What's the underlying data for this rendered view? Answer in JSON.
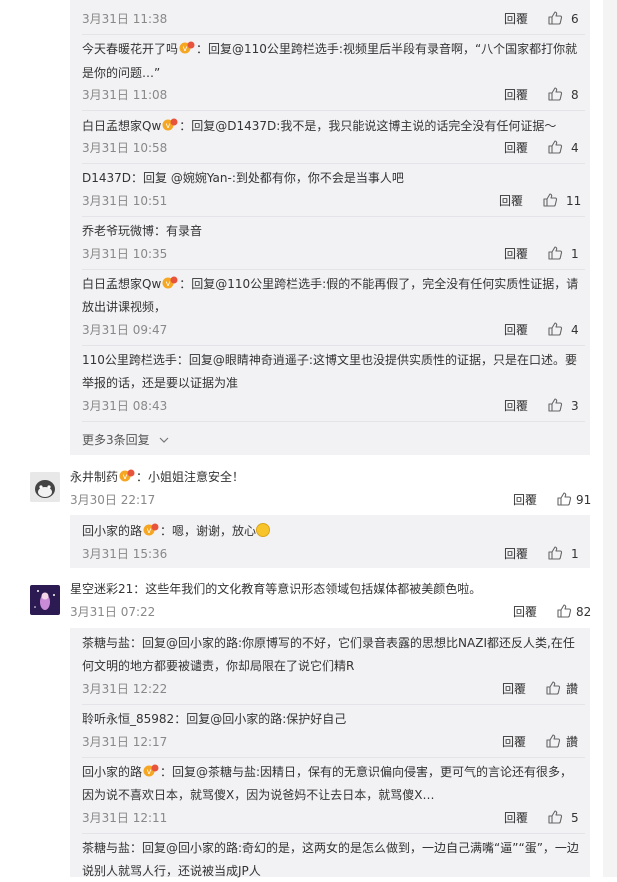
{
  "actions": {
    "reply": "回覆",
    "more_replies": "更多3条回复",
    "praise": "讚"
  },
  "comments": [
    {
      "time": "3月31日 11:38",
      "likes": "6"
    },
    {
      "name": "今天春暖花开了吗",
      "text1": "：回复@110公里跨栏选手:视频里后半段有录音啊，“八个国家都打你就",
      "text2": "是你的问题…”",
      "time": "3月31日 11:08",
      "likes": "8"
    },
    {
      "name": "白日孟想家Qw",
      "text1": "：回复@D1437D:我不是，我只能说这博主说的话完全没有任何证据～",
      "time": "3月31日 10:58",
      "likes": "4"
    },
    {
      "name": "D1437D",
      "text1": "：回复 @婉婉Yan-:到处都有你，你不会是当事人吧",
      "time": "3月31日 10:51",
      "likes": "11"
    },
    {
      "name": "乔老爷玩微博",
      "text1": "：有录音",
      "time": "3月31日 10:35",
      "likes": "1"
    },
    {
      "name": "白日孟想家Qw",
      "text1": "：回复@110公里跨栏选手:假的不能再假了，完全没有任何实质性证据，请",
      "text2": "放出讲课视频，",
      "time": "3月31日 09:47",
      "likes": "4"
    },
    {
      "name": "110公里跨栏选手",
      "text1": "：回复@眼睛神奇逍遥子:这博文里也没提供实质性的证据，只是在口述。要",
      "text2": "举报的话，还是要以证据为准",
      "time": "3月31日 08:43",
      "likes": "3"
    }
  ],
  "top1": {
    "name": "永井制药",
    "text": "：小姐姐注意安全！",
    "time": "3月30日 22:17",
    "likes": "91"
  },
  "top1_reply": {
    "name": "回小家的路",
    "text": "：嗯，谢谢，放心",
    "time": "3月31日 15:36",
    "likes": "1"
  },
  "top2": {
    "name": "星空迷彩21",
    "text": "：这些年我们的文化教育等意识形态领域包括媒体都被美颜色啦。",
    "time": "3月31日 07:22",
    "likes": "82"
  },
  "top2_replies": [
    {
      "name": "茶糖与盐",
      "text1": "：回复@回小家的路:你原博写的不好，它们录音表露的思想比NAZI都还反人类,在任",
      "text2": "何文明的地方都要被谴责，你却局限在了说它们精R",
      "time": "3月31日 12:22"
    },
    {
      "name": "聆听永恒_85982",
      "text1": "：回复@回小家的路:保护好自己",
      "time": "3月31日 12:17"
    },
    {
      "name": "回小家的路",
      "text1": "：回复@茶糖与盐:因精日，保有的无意识偏向侵害，更可气的言论还有很多，",
      "text2": "因为说不喜欢日本，就骂傻X，因为说爸妈不让去日本，就骂傻X…",
      "time": "3月31日 12:11",
      "likes": "5"
    },
    {
      "name": "茶糖与盐",
      "text1": "：回复@回小家的路:奇幻的是，这两女的是怎么做到，一边自己满嘴“逼”“蛋”，一边",
      "text2": "说别人就骂人行，还说被当成JP人"
    }
  ]
}
